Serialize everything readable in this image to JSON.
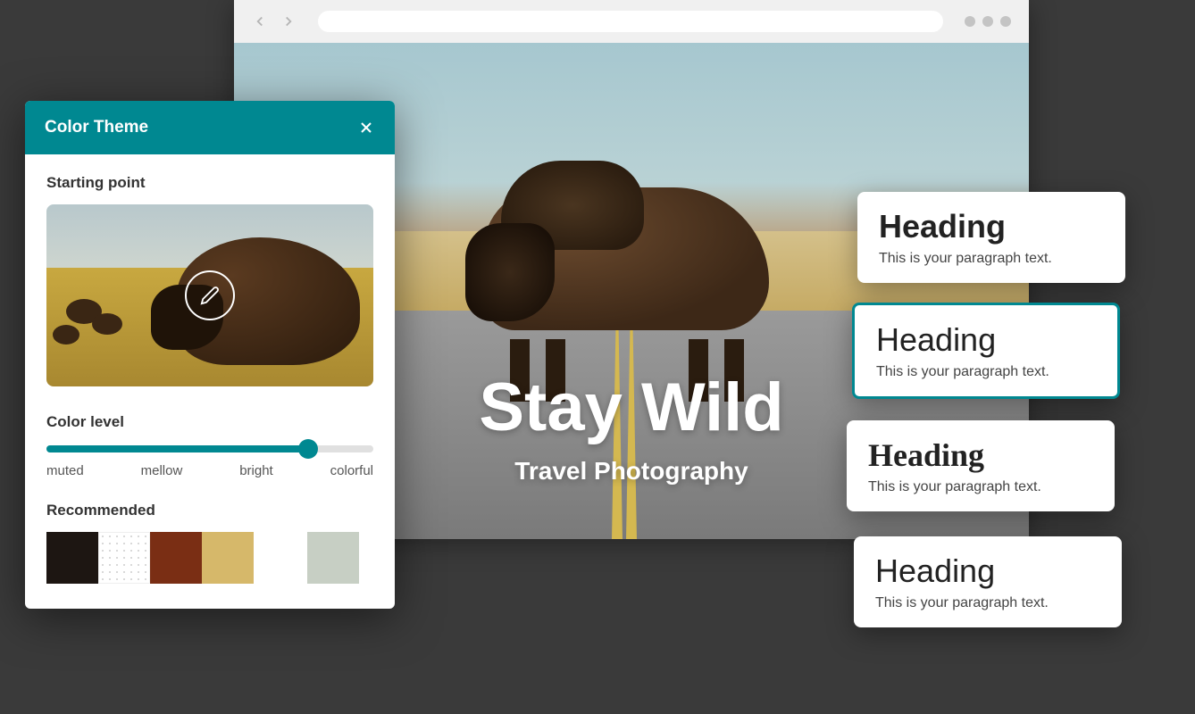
{
  "panel": {
    "title": "Color Theme",
    "startingPoint": "Starting point",
    "colorLevel": "Color level",
    "sliderLabels": [
      "muted",
      "mellow",
      "bright",
      "colorful"
    ],
    "recommended": "Recommended",
    "swatches": [
      "#1d1612",
      "dotted",
      "#7a2e14",
      "#d6b86a",
      "gap",
      "#c7cfc4"
    ]
  },
  "hero": {
    "title": "Stay Wild",
    "subtitle": "Travel Photography"
  },
  "cards": [
    {
      "heading": "Heading",
      "text": "This is your paragraph text."
    },
    {
      "heading": "Heading",
      "text": "This is your paragraph text."
    },
    {
      "heading": "Heading",
      "text": "This is your paragraph text."
    },
    {
      "heading": "Heading",
      "text": "This is your paragraph text."
    }
  ]
}
